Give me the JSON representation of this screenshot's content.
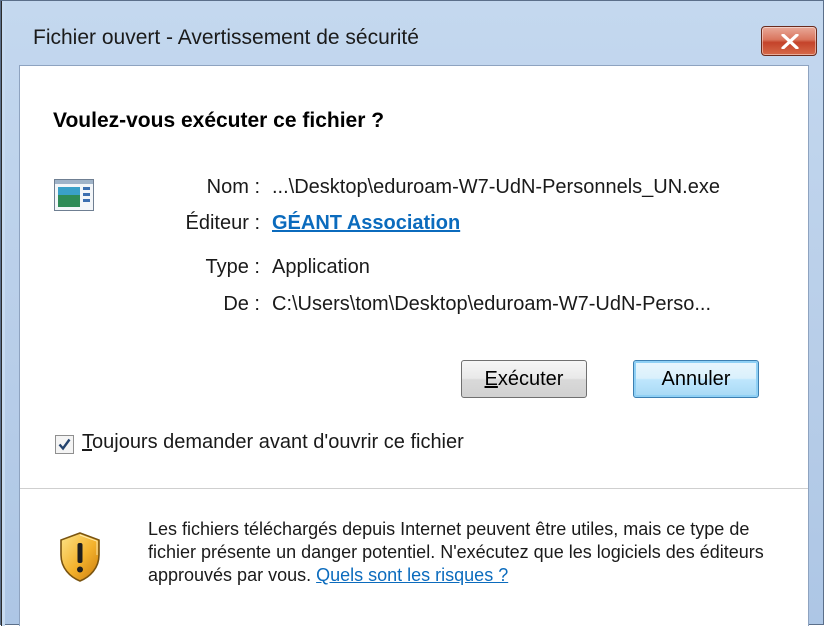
{
  "window": {
    "title": "Fichier ouvert - Avertissement de sécurité"
  },
  "dialog": {
    "heading": "Voulez-vous exécuter ce fichier ?",
    "fields": {
      "name_label": "Nom :",
      "name_value": "...\\Desktop\\eduroam-W7-UdN-Personnels_UN.exe",
      "publisher_label": "Éditeur :",
      "publisher_value": "GÉANT Association",
      "type_label": "Type :",
      "type_value": "Application",
      "from_label": "De :",
      "from_value": "C:\\Users\\tom\\Desktop\\eduroam-W7-UdN-Perso..."
    },
    "buttons": {
      "run_mnemonic": "E",
      "run_rest": "xécuter",
      "cancel_label": "Annuler"
    },
    "checkbox": {
      "checked": true,
      "label_mnemonic": "T",
      "label_rest": "oujours demander avant d'ouvrir ce fichier"
    },
    "warning": {
      "text": "Les fichiers téléchargés depuis Internet peuvent être utiles, mais ce type de fichier présente un danger potentiel. N'exécutez que les logiciels des éditeurs approuvés par vous. ",
      "link": "Quels sont les risques ?"
    }
  },
  "icons": {
    "close": "close-icon",
    "file": "application-file-icon",
    "shield": "security-shield-warning-icon",
    "check": "checkmark-icon"
  },
  "colors": {
    "link": "#0b6bbd",
    "close_button": "#c4432a",
    "default_button_glow": "#8fd0f5"
  }
}
